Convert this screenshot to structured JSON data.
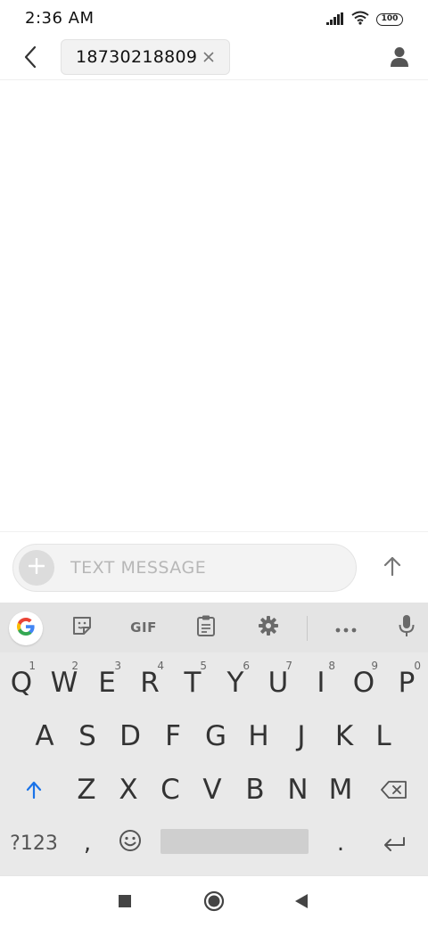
{
  "status_bar": {
    "time": "2:36 AM",
    "battery": "100",
    "icons": [
      "signal-icon",
      "wifi-icon",
      "battery-icon"
    ]
  },
  "header": {
    "recipient": "18730218809",
    "icons": [
      "back-arrow-icon",
      "close-icon",
      "contact-icon"
    ]
  },
  "compose": {
    "placeholder": "TEXT MESSAGE",
    "value": ""
  },
  "keyboard": {
    "toolbar": {
      "gif_label": "GIF",
      "icons": [
        "google-icon",
        "sticker-icon",
        "clipboard-icon",
        "gear-icon",
        "more-icon",
        "mic-icon"
      ]
    },
    "row1": [
      {
        "label": "Q",
        "hint": "1"
      },
      {
        "label": "W",
        "hint": "2"
      },
      {
        "label": "E",
        "hint": "3"
      },
      {
        "label": "R",
        "hint": "4"
      },
      {
        "label": "T",
        "hint": "5"
      },
      {
        "label": "Y",
        "hint": "6"
      },
      {
        "label": "U",
        "hint": "7"
      },
      {
        "label": "I",
        "hint": "8"
      },
      {
        "label": "O",
        "hint": "9"
      },
      {
        "label": "P",
        "hint": "0"
      }
    ],
    "row2": [
      "A",
      "S",
      "D",
      "F",
      "G",
      "H",
      "J",
      "K",
      "L"
    ],
    "row3": [
      "Z",
      "X",
      "C",
      "V",
      "B",
      "N",
      "M"
    ],
    "row4": {
      "symbols_label": "?123",
      "comma": ",",
      "period": "."
    }
  },
  "colors": {
    "accent": "#1a73e8",
    "keyboard_bg": "#e9e9e9",
    "icon_gray": "#6a6a6a"
  }
}
